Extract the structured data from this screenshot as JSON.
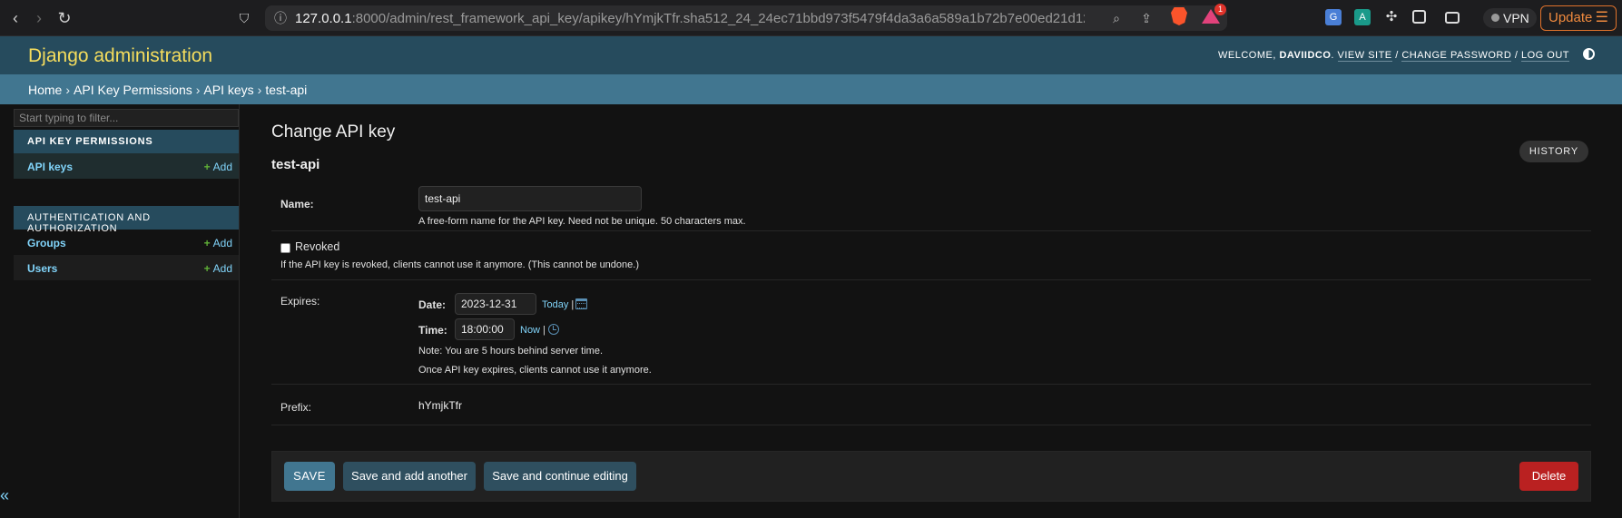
{
  "browser": {
    "back_glyph": "‹",
    "forward_glyph": "›",
    "reload_glyph": "↻",
    "bookmark_glyph": "⛉",
    "url_host": "127.0.0.1",
    "url_rest": ":8000/admin/rest_framework_api_key/apikey/hYmjkTfr.sha512_24_24ec71bbd973f5479f4da3a6a589a1b72b7e00ed21d12...",
    "rewards_badge": "1",
    "vpn_label": "VPN",
    "update_label": "Update",
    "icons": [
      "back-arrow-icon",
      "forward-arrow-icon",
      "reload-icon",
      "bookmark-icon",
      "site-info-icon",
      "zoom-icon",
      "share-icon",
      "brave-shields-icon",
      "brave-rewards-icon",
      "translate-icon",
      "extension-icon",
      "puzzle-icon",
      "sidebar-icon",
      "wallet-icon",
      "menu-icon"
    ]
  },
  "header": {
    "brand": "Django administration",
    "welcome": "WELCOME, ",
    "username": "DAVIIDCO",
    "view_site": "VIEW SITE",
    "change_password": "CHANGE PASSWORD",
    "log_out": "LOG OUT",
    "slash": " / "
  },
  "breadcrumbs": {
    "items": [
      "Home",
      "API Key Permissions",
      "API keys",
      "test-api"
    ],
    "separator": "›"
  },
  "sidebar": {
    "filter_placeholder": "Start typing to filter...",
    "modules": [
      {
        "caption": "API KEY PERMISSIONS",
        "rows": [
          {
            "label": "API keys",
            "add": "Add"
          }
        ]
      },
      {
        "caption": "AUTHENTICATION AND AUTHORIZATION",
        "rows": [
          {
            "label": "Groups",
            "add": "Add"
          },
          {
            "label": "Users",
            "add": "Add"
          }
        ]
      }
    ],
    "collapse_glyph": "«"
  },
  "content": {
    "title": "Change API key",
    "object_title": "test-api",
    "history_label": "HISTORY",
    "name": {
      "label": "Name:",
      "value": "test-api",
      "help": "A free-form name for the API key. Need not be unique. 50 characters max."
    },
    "revoked": {
      "label": "Revoked",
      "checked": false,
      "help": "If the API key is revoked, clients cannot use it anymore. (This cannot be undone.)"
    },
    "expires": {
      "label": "Expires:",
      "date_label": "Date:",
      "date_value": "2023-12-31",
      "today_label": "Today",
      "time_label": "Time:",
      "time_value": "18:00:00",
      "now_label": "Now",
      "pipe": "|",
      "note": "Note: You are 5 hours behind server time.",
      "help": "Once API key expires, clients cannot use it anymore."
    },
    "prefix": {
      "label": "Prefix:",
      "value": "hYmjkTfr"
    },
    "buttons": {
      "save": "SAVE",
      "save_add_another": "Save and add another",
      "save_continue": "Save and continue editing",
      "delete": "Delete"
    }
  }
}
